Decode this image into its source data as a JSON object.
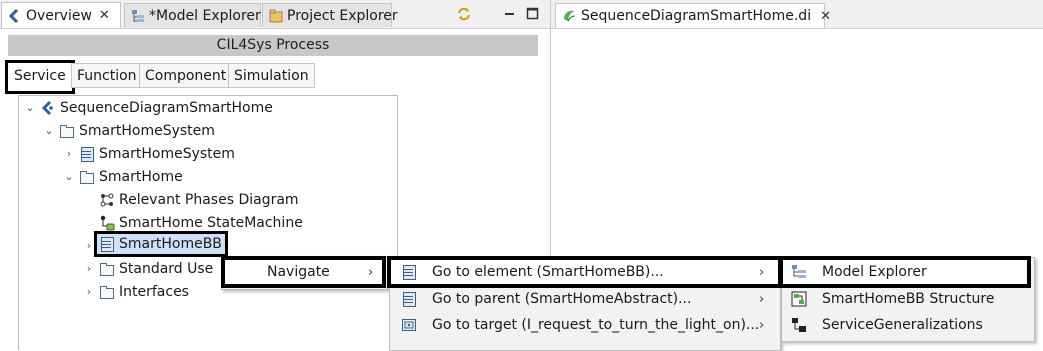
{
  "left_view": {
    "tabs": [
      {
        "label": "Overview",
        "icon": "overview-icon",
        "active": true,
        "closable": true
      },
      {
        "label": "*Model Explorer",
        "icon": "model-explorer-icon",
        "active": false
      },
      {
        "label": "Project Explorer",
        "icon": "project-explorer-icon",
        "active": false
      }
    ],
    "toolbar_icons": [
      "sync-icon",
      "minimize-icon",
      "maximize-icon"
    ],
    "header": "CIL4Sys Process",
    "category_tabs": [
      "Service",
      "Function",
      "Component",
      "Simulation"
    ],
    "selected_category": "Service",
    "tree": [
      {
        "label": "SequenceDiagramSmartHome",
        "icon": "papyrus-model-icon",
        "expander": "expanded"
      },
      {
        "label": "SmartHomeSystem",
        "icon": "package-folder-icon",
        "expander": "expanded"
      },
      {
        "label": "SmartHomeSystem",
        "icon": "block-icon",
        "expander": "collapsed"
      },
      {
        "label": "SmartHome",
        "icon": "package-folder-icon",
        "expander": "expanded"
      },
      {
        "label": "Relevant Phases Diagram",
        "icon": "phases-diagram-icon",
        "expander": "none"
      },
      {
        "label": "SmartHome StateMachine",
        "icon": "state-machine-icon",
        "expander": "none"
      },
      {
        "label": "SmartHomeBB",
        "icon": "block-icon",
        "expander": "collapsed",
        "selected": true
      },
      {
        "label": "Standard Use",
        "icon": "package-folder-icon",
        "expander": "collapsed"
      },
      {
        "label": "Interfaces",
        "icon": "package-folder-icon",
        "expander": "collapsed"
      }
    ]
  },
  "context_menu": {
    "level1": [
      {
        "label": "Navigate",
        "arrow": "›"
      }
    ],
    "level2": [
      {
        "label": "Go to element (SmartHomeBB)...",
        "icon": "block-icon",
        "arrow": "›"
      },
      {
        "label": "Go to parent (SmartHomeAbstract)...",
        "icon": "block-icon",
        "arrow": "›"
      },
      {
        "label": "Go to target (I_request_to_turn_the_light_on)...",
        "icon": "target-icon",
        "arrow": "›"
      }
    ],
    "level3": [
      {
        "label": "Model Explorer",
        "icon": "model-explorer-icon"
      },
      {
        "label": "SmartHomeBB Structure",
        "icon": "structure-diagram-icon"
      },
      {
        "label": "ServiceGeneralizations",
        "icon": "generalization-icon"
      }
    ]
  },
  "editor": {
    "tab_label": "SequenceDiagramSmartHome.di",
    "tab_icon": "papyrus-di-icon"
  },
  "colors": {
    "highlight_border": "#000000",
    "selection_fill": "#cfe1f5",
    "menu_bg": "#f2f2f2",
    "header_bg": "#c8c8c8"
  }
}
